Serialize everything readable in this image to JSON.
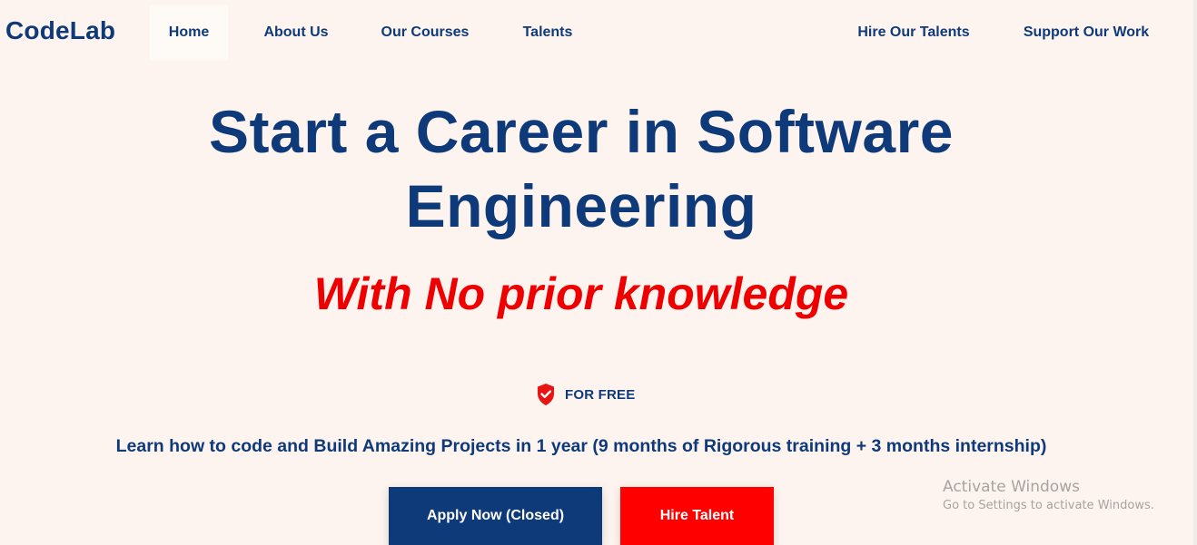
{
  "brand": {
    "name": "CodeLab"
  },
  "nav": {
    "home": "Home",
    "about": "About Us",
    "courses": "Our Courses",
    "talents": "Talents",
    "hire_talents": "Hire Our Talents",
    "support": "Support Our Work"
  },
  "hero": {
    "title": "Start a Career in Software Engineering",
    "subtitle": "With No prior knowledge",
    "badge_icon": "shield-check-icon",
    "badge_label": "FOR FREE",
    "description": "Learn how to code and Build Amazing Projects in 1 year (9 months of Rigorous training + 3 months internship)"
  },
  "actions": {
    "apply_label": "Apply Now (Closed)",
    "hire_label": "Hire Talent"
  },
  "watermark": {
    "title": "Activate Windows",
    "subtitle": "Go to Settings to activate Windows."
  },
  "colors": {
    "background": "#fdf4ef",
    "primary": "#0e3a7a",
    "accent_red": "#ee0000",
    "button_red": "#ff0000"
  }
}
